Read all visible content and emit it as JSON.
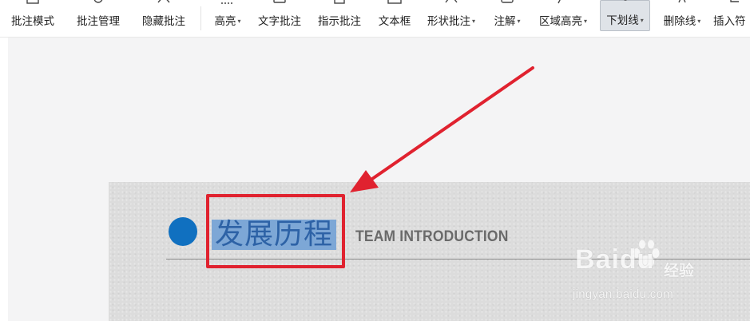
{
  "toolbar": {
    "items": [
      {
        "label": "批注模式",
        "dropdown": false,
        "icon": "annotation-mode-icon"
      },
      {
        "label": "批注管理",
        "dropdown": false,
        "icon": "annotation-manage-icon"
      },
      {
        "label": "隐藏批注",
        "dropdown": false,
        "icon": "hide-annotation-icon"
      },
      {
        "label": "高亮",
        "dropdown": true,
        "icon": "highlight-icon"
      },
      {
        "label": "文字批注",
        "dropdown": false,
        "icon": "text-annotation-icon"
      },
      {
        "label": "指示批注",
        "dropdown": false,
        "icon": "pointer-annotation-icon"
      },
      {
        "label": "文本框",
        "dropdown": false,
        "icon": "textbox-icon"
      },
      {
        "label": "形状批注",
        "dropdown": true,
        "icon": "shape-annotation-icon"
      },
      {
        "label": "注解",
        "dropdown": true,
        "icon": "comment-icon"
      },
      {
        "label": "区域高亮",
        "dropdown": true,
        "icon": "area-highlight-icon"
      },
      {
        "label": "下划线",
        "dropdown": true,
        "icon": "underline-icon",
        "active": true
      },
      {
        "label": "删除线",
        "dropdown": true,
        "icon": "strikethrough-icon"
      },
      {
        "label": "插入符",
        "dropdown": false,
        "icon": "insert-caret-icon"
      }
    ],
    "caret": "▾"
  },
  "slide": {
    "heading": "发展历程",
    "subheading": "TEAM INTRODUCTION"
  },
  "watermark": {
    "brand": "Baidu",
    "sub": "经验",
    "url": "jingyan.baidu.com"
  },
  "colors": {
    "bullet": "#1070c0",
    "selection": "#7da7d6",
    "heading_text": "#2d62a6",
    "callout_red": "#e0222f",
    "active_tool_bg": "#dfe3e8"
  }
}
